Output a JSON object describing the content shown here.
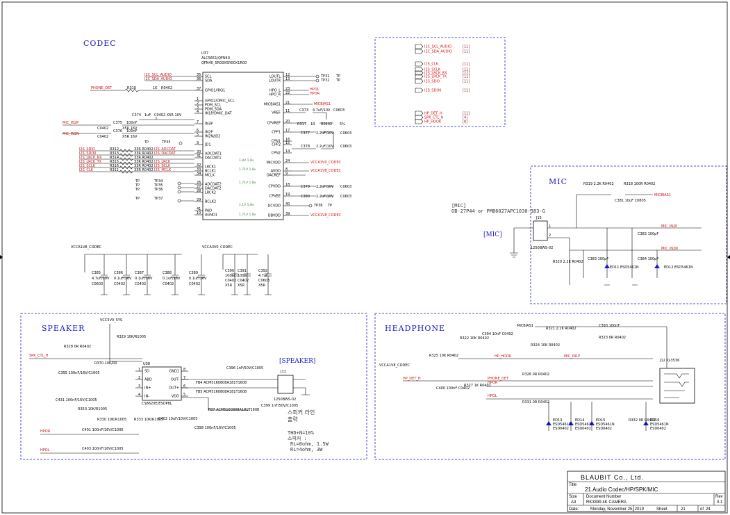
{
  "sections": {
    "codec": "CODEC",
    "mic": "MIC",
    "speaker": "SPEAKER",
    "headphone": "HEADPHONE",
    "speaker_conn": "[SPEAKER]",
    "mic_conn": "[MIC]"
  },
  "codec_chip": {
    "ref": "U37",
    "part": "ALC5651/QFN40",
    "pkg": "QFN40_5R00X5R00X1R00",
    "left_pins": [
      {
        "num": "35",
        "name": "SCL",
        "net": "I2C_SCL_AUDIO"
      },
      {
        "num": "36",
        "name": "SDA",
        "net": "I2C_SDA_AUDIO"
      },
      {
        "num": "37",
        "name": "GPIO1/IRQ1",
        "net": "PHONE_DET"
      },
      {
        "num": "1",
        "name": "GPIO2/DMIC_SCL",
        "net": ""
      },
      {
        "num": "2",
        "name": "PDM_SCL",
        "net": ""
      },
      {
        "num": "3",
        "name": "PDM_SDA",
        "net": ""
      },
      {
        "num": "4",
        "name": "IN1P/DMIC_DAT",
        "net": ""
      },
      {
        "num": "7",
        "name": "IN3P",
        "net": "MIC_IN2P"
      },
      {
        "num": "6",
        "name": "IN2P",
        "net": "MIC_IN2N"
      },
      {
        "num": "5",
        "name": "IN2N/JD2",
        "net": ""
      },
      {
        "num": "9",
        "name": "JD1",
        "net": "TP33"
      },
      {
        "num": "30",
        "name": "ADCDAT1",
        "net": "I2S1_ADCDAT"
      },
      {
        "num": "31",
        "name": "DACDAT1",
        "net": "I2S1_DACDAT"
      },
      {
        "num": "32",
        "name": "LRCK1",
        "net": "I2S1_LRCK"
      },
      {
        "num": "33",
        "name": "BCLK1",
        "net": "I2S1_BCLK"
      },
      {
        "num": "34",
        "name": "MCLK",
        "net": "I2S1_MCLK"
      },
      {
        "num": "26",
        "name": "ADCDAT2",
        "net": "TP34"
      },
      {
        "num": "27",
        "name": "DACDAT2",
        "net": "TP35"
      },
      {
        "num": "28",
        "name": "LRCK2",
        "net": "TP36"
      },
      {
        "num": "29",
        "name": "BCLK2",
        "net": "TP37"
      },
      {
        "num": "41",
        "name": "PAD",
        "net": ""
      },
      {
        "num": "10",
        "name": "AGND1",
        "net": ""
      }
    ],
    "right_pins": [
      {
        "num": "12",
        "name": "LOUTL",
        "net": "TP31"
      },
      {
        "num": "13",
        "name": "LOUTR",
        "net": "TP32"
      },
      {
        "num": "23",
        "name": "HPO_L",
        "net": "HPOL"
      },
      {
        "num": "22",
        "name": "HPO_R",
        "net": "HPOR"
      },
      {
        "num": "21",
        "name": "MICBIAS1",
        "net": "MICBIAS1"
      },
      {
        "num": "11",
        "name": "VREF",
        "net": "C373"
      },
      {
        "num": "20",
        "name": "CPVREF",
        "net": "R317"
      },
      {
        "num": "17",
        "name": "CPP1",
        "net": "C377"
      },
      {
        "num": "16",
        "name": "CPN1",
        "net": ""
      },
      {
        "num": "15",
        "name": "CPP2",
        "net": "C378"
      },
      {
        "num": "14",
        "name": "CPN2",
        "net": ""
      },
      {
        "num": "24",
        "name": "MICVDD",
        "net": "VCCA3V0_CODEC"
      },
      {
        "num": "8",
        "name": "AVDD",
        "net": "VCCA1V8_CODEC"
      },
      {
        "num": "9",
        "name": "DACREF",
        "net": ""
      },
      {
        "num": "18",
        "name": "CPVDD",
        "net": "C379"
      },
      {
        "num": "19",
        "name": "CPVEE",
        "net": "C380"
      },
      {
        "num": "40",
        "name": "DCVDD",
        "net": "TP38"
      },
      {
        "num": "39",
        "name": "DBVDD",
        "net": "VCCA1V8_CODEC"
      }
    ]
  },
  "codec_caps": {
    "vcca1v8": "VCCA1V8_CODEC",
    "vcca3v0": "VCCA3V0_CODEC",
    "left": [
      {
        "ref": "C385",
        "val": "4.7uF/10V",
        "pkg": "C0603"
      },
      {
        "ref": "C386",
        "val": "0.1uF/16V",
        "pkg": "C0402"
      },
      {
        "ref": "C387",
        "val": "0.1uF/16V",
        "pkg": "C0402"
      },
      {
        "ref": "C388",
        "val": "0.1uF/16V",
        "pkg": "C0402"
      },
      {
        "ref": "C389",
        "val": "0.1uF/16V",
        "pkg": "C0402"
      }
    ],
    "right": [
      {
        "ref": "C390",
        "val": "100nF",
        "pkg": "C0402"
      },
      {
        "ref": "C391",
        "val": "100nF",
        "pkg": "C0402"
      },
      {
        "ref": "C392",
        "val": "4.7uF",
        "pkg": "C0603"
      }
    ]
  },
  "netlist_box": {
    "ports": [
      {
        "net": "I2C_SCL_AUDIO",
        "ref": "[11]"
      },
      {
        "net": "I2C_SDA_AUDIO",
        "ref": "[11]"
      },
      {
        "net": "I2S_CLK",
        "ref": "[11]"
      },
      {
        "net": "I2S_SCLK",
        "ref": "[11]"
      },
      {
        "net": "I2S_LRCK_RX",
        "ref": "[11]"
      },
      {
        "net": "I2S_LRCK_TX",
        "ref": "[11]"
      },
      {
        "net": "I2S_SDI0",
        "ref": "[11]"
      },
      {
        "net": "I2S_SDO0",
        "ref": "[11]"
      },
      {
        "net": "HP_DET_H",
        "ref": "[11]"
      },
      {
        "net": "SPK_CTL_H",
        "ref": "[4]"
      },
      {
        "net": "HP_HOOK",
        "ref": "[8]"
      }
    ]
  },
  "mic": {
    "note1": "[MIC]",
    "note2": "OB-27P44 or PMB6027APC1030-383-G",
    "jack": "J15",
    "jack_part": "1250BWS-02",
    "r319": "R319 2.2K R0402",
    "r318": "R318 100R R0402",
    "c381": "C381 10uF C0805",
    "c382": "C382 100pF",
    "c383": "C383 100pF",
    "c384": "C384 100pF",
    "r320": "R320 2.2K R0402",
    "ed11": "ED11 ESD5461N",
    "ed12": "ED12 ESD5461N",
    "micbias": "MICBIAS1",
    "inp": "MIC_IN2P",
    "inn": "MIC_IN2N"
  },
  "speaker": {
    "supply": "VCC5V0_SYS",
    "amp": "U38",
    "amp_part": "CS8620E/ESOP8L",
    "amp_pins": [
      "SD",
      "ABD",
      "IN+",
      "IN-",
      "GND1",
      "OUT-",
      "OUT+",
      "VDD"
    ],
    "spk_ctl": "SPK_CTL_H",
    "r328": "R328 0R R0402",
    "r329": "R329 10K/R1005",
    "r370": "R370 10K/R0",
    "c395": "C395 100nF/16V/C1005",
    "c431": "C431 100nF/16V/C1005",
    "r353": "R353 10K/R1005",
    "r330": "R330 10K/R1005",
    "r333": "R333 10K/R1005",
    "c401": "C401 100nF/16V/C1005",
    "c403": "C403 100nF/16V/C1005",
    "c402": "C402 10uF/10V/C1605",
    "c398": "C398 100nF/16V/C1005",
    "fb4": "FB4 ACM5160808A181T1608",
    "fb5": "FB5 ACM5160808A181T1608",
    "fb7": "FB7 ACM5160808A181T1608",
    "c396": "C396 1nF/50V/C1005",
    "c399": "C399 1nF/50V/C1005",
    "j11": "J11",
    "j11_part": "1250BWS-02",
    "hpor": "HPOR",
    "hpol": "HPOL",
    "note_ko_1": "스피커 라인",
    "note_ko_2": "출력",
    "spec1": "THD+N=10%",
    "spec2": "스피커 :",
    "spec3": "RL=8ohm, 1.5W",
    "spec4": "RL=4ohm, 3W"
  },
  "headphone": {
    "micbias": "MICBIAS1",
    "r321": "R321 2.2K R0402",
    "c393": "C393 100nF",
    "r322": "R322 10K R0402",
    "c394": "C394 10nF C0402",
    "r324": "R324 10K R0402",
    "r323": "R323 0R R0402",
    "r325": "R325 10K R0402",
    "vcc": "VCCA1V8_CODEC",
    "hp_hook": "HP_HOOK",
    "mic_in1p": "MIC_IN1P",
    "hp_det": "HP_DET_H",
    "c400": "C400 100nF C0402",
    "r327": "R327 1K R0402",
    "r326": "R326 0R R0402",
    "phone_det": "PHONE_DET",
    "hpor": "HPOR",
    "hpol": "HPOL",
    "r331": "R331 0R R0402",
    "r332": "R332 0R R0402",
    "j12": "J12 PJ-3536",
    "esd": [
      "ED13 ESD5461N",
      "ED14 ESD5461N",
      "ED15 ESD5461N",
      "ED16 ESD5461N"
    ]
  },
  "title_block": {
    "company": "BLAUBIT Co., Ltd.",
    "title_label": "Title",
    "title": "21.Audio Codec/HP/SPK/MIC",
    "size_label": "Size",
    "size": "A3",
    "doc_label": "Document Number",
    "doc": "RK3399 4K CAMERA",
    "rev_label": "Rev",
    "rev": "0.1",
    "date_label": "Date:",
    "date": "Monday, November 25, 2019",
    "sheet_label": "Sheet",
    "sheet": "21",
    "of_label": "of",
    "of": "24"
  }
}
